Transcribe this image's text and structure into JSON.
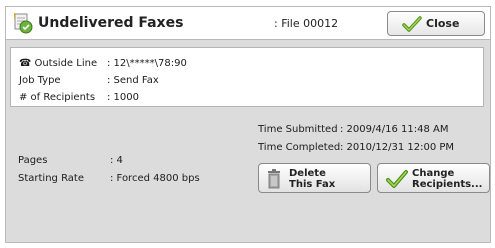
{
  "header": {
    "title": "Undelivered Faxes",
    "file": ": File 00012",
    "close_label": "Close"
  },
  "info": {
    "outside_line_label": "Outside Line",
    "outside_line_value": ": 12\\*****\\78:90",
    "job_type_label": "Job Type",
    "job_type_value": ": Send Fax",
    "recipients_label": "# of Recipients",
    "recipients_value": ": 1000"
  },
  "details": {
    "time_submitted_label": "Time Submitted",
    "time_submitted_value": ": 2009/4/16 11:48 AM",
    "time_completed_label": "Time Completed",
    "time_completed_value": ": 2010/12/31 12:00 PM",
    "pages_label": "Pages",
    "pages_value": ": 4",
    "starting_rate_label": "Starting Rate",
    "starting_rate_value": ": Forced 4800 bps"
  },
  "actions": {
    "delete_label": "Delete\nThis Fax",
    "change_label": "Change\nRecipients..."
  },
  "colors": {
    "panel": "#dcdcdc",
    "check_green": "#5a9e1a",
    "check_yellow": "#e8c23a"
  }
}
